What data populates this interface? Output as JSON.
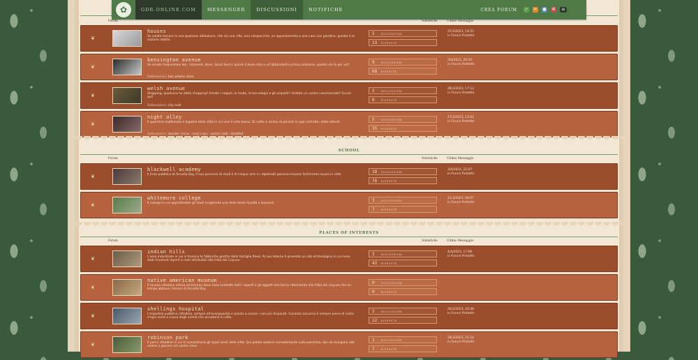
{
  "topnav": {
    "brand": "GDR-ONLINE.COM",
    "links": [
      "MESSENGER",
      "DISCUSSIONI",
      "NOTIFICHE"
    ],
    "create": "CREA FORUM"
  },
  "col_headers": {
    "forum": "Forum",
    "stats": "Statistiche",
    "last": "Ultimo Messaggio"
  },
  "sections": [
    {
      "title": "",
      "rows": [
        {
          "name": "houses",
          "desc": "Se volete trovare in una qualsiasi abitazione, che sia una villa, una catapecchia, un appartamento o una casa con giardino, questa è la sezione adatta.",
          "subforums_label": "",
          "subforums": "",
          "discussions": "5",
          "replies": "13",
          "date": "25/3/2023, 18:25",
          "in": "in Forum Protetto"
        },
        {
          "name": "kensington avenue",
          "desc": "Se amate frequentare bar, ristoranti, diner, locali diurni, quindi il buon cibo o un'abbondante prima colazione, questa via fa per voi!",
          "subforums_label": "Sottosezioni:",
          "subforums": "two whales diner",
          "discussions": "9",
          "replies": "68",
          "date": "3/4/2023, 20:54",
          "in": "in Forum Protetto"
        },
        {
          "name": "welsh avenue",
          "desc": "Shopping, qualcuno ha detto shopping? Amate i negozi, la moda, la tecnologia e gli acquisti? Visitate un centro commerciale? Eccoci qui!",
          "subforums_label": "Sottosezioni:",
          "subforums": "city mall",
          "discussions": "2",
          "replies": "6",
          "date": "28/3/2023, 17:13",
          "in": "in Forum Protetto"
        },
        {
          "name": "night alley",
          "desc": "Il quartiere malfamato e lugubre della città in cui vive il ceto basso. Di notte si anima di pericoli in ogni anfratto, state attenti.",
          "subforums_label": "Sottosezioni:",
          "subforums": "wonder circus · rony's bar · vortex club · deadfall",
          "discussions": "5",
          "replies": "35",
          "date": "27/3/2023, 13:42",
          "in": "in Forum Protetto"
        }
      ]
    },
    {
      "title": "SCHOOL",
      "rows": [
        {
          "name": "blackwell academy",
          "desc": "Il liceo pubblico di Arcadia Bay. Il suo percorso di studi è di cinque anni e i diplomati possono trovare facilmente lavoro in città.",
          "subforums_label": "",
          "subforums": "",
          "discussions": "18",
          "replies": "76",
          "date": "3/4/2023, 22:07",
          "in": "in Forum Protetto"
        },
        {
          "name": "whitemore college",
          "desc": "Il college in cui approfondire gli studi scegliendo una delle tante facoltà e lauresrsi.",
          "subforums_label": "",
          "subforums": "",
          "discussions": "3",
          "replies": "7",
          "date": "22/3/2023, 09:07",
          "in": "in Forum Protetto"
        }
      ]
    },
    {
      "title": "PLACES OF INTERESTS",
      "rows": [
        {
          "name": "indian hills",
          "desc": "L'area industriale in cui si trovano le fabbriche gestite dalla famiglia Reed. Al suo interno è presente un sito archeologico in cui sono stati rinvenuti reperti e resti attribuibili alla tribù dei Cayuse.",
          "subforums_label": "",
          "subforums": "",
          "discussions": "3",
          "replies": "43",
          "date": "4/4/2023, 17:09",
          "in": "in Forum Protetto"
        },
        {
          "name": "native american museum",
          "desc": "Il museo cittadino nativo americano dove sono custoditi tutti i reperti e gli oggetti che fanno riferimento alla tribù dei Cayuse che un tempo abitava i terreni di Arcadia Bay.",
          "subforums_label": "",
          "subforums": "",
          "discussions": "0",
          "replies": "0",
          "date": "",
          "in": ""
        },
        {
          "name": "shellings hospital",
          "desc": "L'ospedale pubblico cittadino, sempre all'avanguardia e pronto a curare i casi più disparati. Il pronto soccorso è sempre pieno di codici d'ogni sorta a causa degli eventi che accadono in città.",
          "subforums_label": "",
          "subforums": "",
          "discussions": "3",
          "replies": "12",
          "date": "26/3/2023, 20:38",
          "in": "in Forum Protetto"
        },
        {
          "name": "robinson park",
          "desc": "Il parco cittadino in cui si concentrano gli spazi verdi della città. Qui potete sedervi comodamente sulle panchine, dar da mangiare alle anatre o giocare col vostro cane.",
          "subforums_label": "",
          "subforums": "",
          "discussions": "1",
          "replies": "7",
          "date": "28/3/2023, 21:14",
          "in": "in Forum Protetto"
        }
      ]
    }
  ],
  "stat_words": {
    "discussions": "DISCUSSIONI",
    "replies": "RISPOSTE"
  },
  "colors": {
    "nav_green": "#4f7a47",
    "row_dark": "#9c4d2c",
    "row_light": "#b8633f",
    "section_title": "#4f7a47"
  }
}
